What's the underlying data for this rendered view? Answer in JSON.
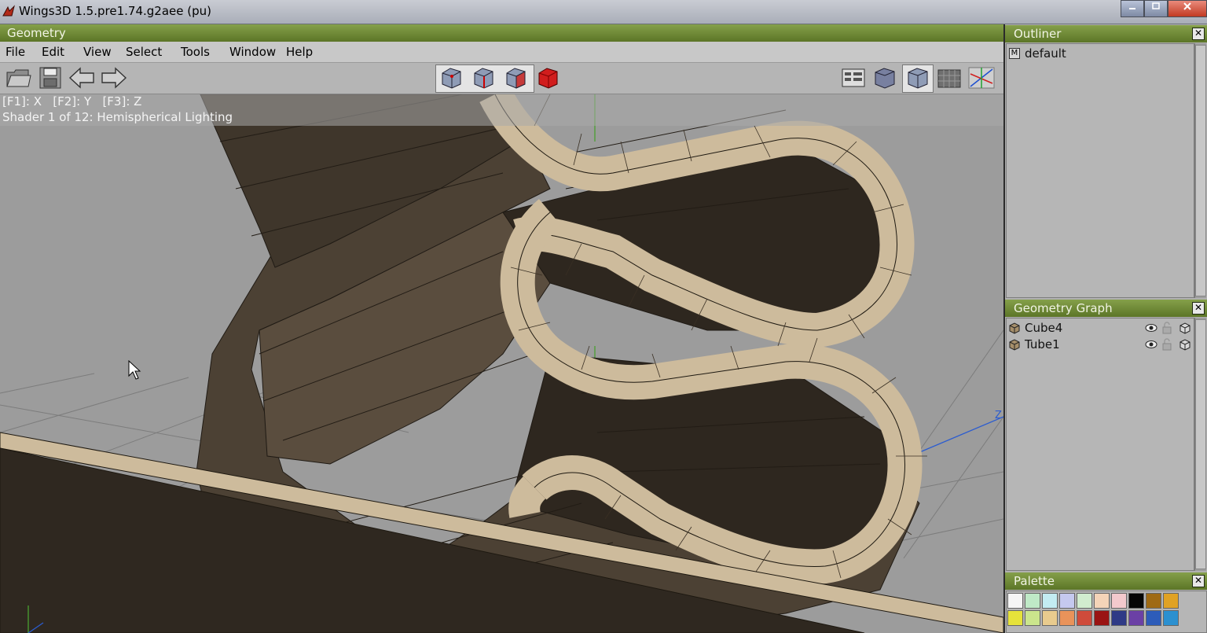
{
  "window": {
    "title": "Wings3D 1.5.pre1.74.g2aee (pu)"
  },
  "geometry": {
    "header": "Geometry",
    "menu": [
      "File",
      "Edit",
      "View",
      "Select",
      "Tools",
      "Window",
      "Help"
    ],
    "toolbar": {
      "left": [
        "open-file-icon",
        "save-icon",
        "undo-arrow-icon",
        "redo-arrow-icon"
      ],
      "selection_modes": [
        "vertex-mode-icon",
        "edge-mode-icon",
        "face-mode-icon",
        "body-mode-icon"
      ],
      "right": [
        "workmode-icon",
        "smooth-shaded-icon",
        "wireframe-cube-icon",
        "ground-plane-icon",
        "axes-icon"
      ]
    },
    "info": {
      "axis_line": "[F1]: X   [F2]: Y   [F3]: Z",
      "shader_line": "Shader 1 of 12: Hemispherical Lighting"
    },
    "viewport_axis_label": "Z"
  },
  "outliner": {
    "title": "Outliner",
    "close": "✕",
    "items": [
      {
        "badge": "M",
        "label": "default"
      }
    ]
  },
  "geometry_graph": {
    "title": "Geometry Graph",
    "close": "✕",
    "items": [
      {
        "label": "Cube4"
      },
      {
        "label": "Tube1"
      }
    ]
  },
  "palette": {
    "title": "Palette",
    "close": "✕",
    "colors": [
      "#f5f5f5",
      "#bfe9c7",
      "#c3ecf2",
      "#c5c9ef",
      "#d1eccf",
      "#f4d4b8",
      "#f3c9cd",
      "#050505",
      "#9f6a14",
      "#e0a224",
      "#e6e23a",
      "#cbe58c",
      "#e8cb8e",
      "#e9935a",
      "#cf4b3b",
      "#9a1414",
      "#2f3a86",
      "#6b40a5",
      "#2d5cb9",
      "#2b90d0"
    ]
  },
  "colors": {
    "header_green": "#6d8a33",
    "panel_gray": "#b1b1b1",
    "mesh_tan": "#cdbb9c"
  }
}
